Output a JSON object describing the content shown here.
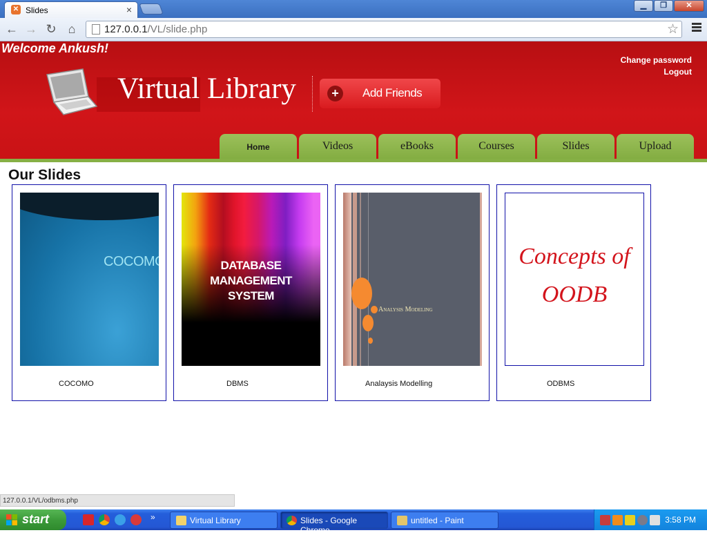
{
  "browser": {
    "tab_title": "Slides",
    "tab_close": "×",
    "url_host": "127.0.0.1",
    "url_path": "/VL/slide.php",
    "status_url": "127.0.0.1/VL/odbms.php",
    "window_buttons": {
      "minimize": "▁",
      "maximize": "❐",
      "close": "✕"
    },
    "icons": [
      "back-icon",
      "forward-icon",
      "reload-icon",
      "home-icon",
      "bookmark-star-icon",
      "menu-icon"
    ]
  },
  "header": {
    "welcome": "Welcome Ankush!",
    "change_password": "Change password",
    "logout": "Logout",
    "site_title": "Virtual Library",
    "add_friends": "Add Friends",
    "nav": [
      {
        "label": "Home"
      },
      {
        "label": "Videos"
      },
      {
        "label": "eBooks"
      },
      {
        "label": "Courses"
      },
      {
        "label": "Slides"
      },
      {
        "label": "Upload"
      }
    ],
    "colors": {
      "brand_red": "#c91215",
      "nav_green": "#86b045"
    }
  },
  "main": {
    "title": "Our Slides",
    "slides": [
      {
        "label": "COCOMO",
        "thumb_text": "COCOMO"
      },
      {
        "label": "DBMS",
        "thumb_text_1": "DATABASE MANAGEMENT",
        "thumb_text_2": "SYSTEM"
      },
      {
        "label": "Analaysis Modelling",
        "thumb_text": "Analysis Modeling"
      },
      {
        "label": "ODBMS",
        "thumb_text_1": "Concepts of",
        "thumb_text_2": "OODB"
      }
    ]
  },
  "taskbar": {
    "start": "start",
    "tasks": [
      {
        "label": "Virtual Library"
      },
      {
        "label": "Slides - Google Chrome"
      },
      {
        "label": "untitled - Paint"
      }
    ],
    "clock": "3:58 PM"
  }
}
